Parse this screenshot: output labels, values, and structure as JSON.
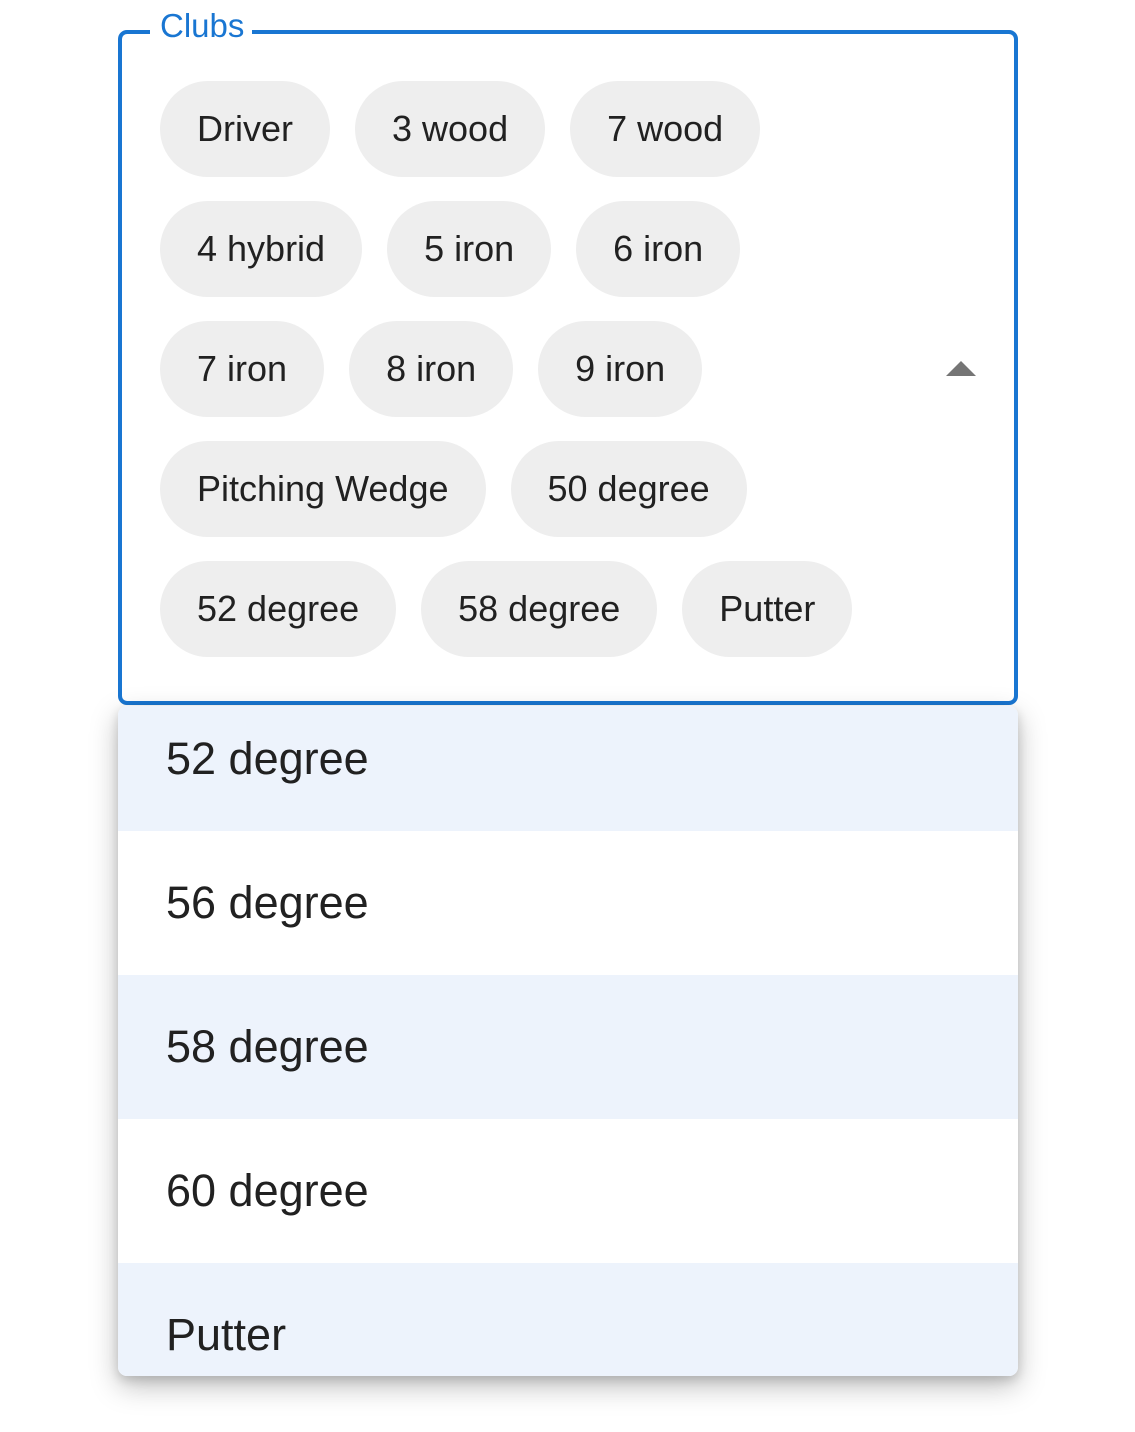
{
  "field": {
    "label": "Clubs",
    "accent_color": "#1976d2",
    "chip_rows": [
      [
        "Driver",
        "3 wood",
        "7 wood"
      ],
      [
        "4 hybrid",
        "5 iron",
        "6 iron"
      ],
      [
        "7 iron",
        "8 iron",
        "9 iron"
      ],
      [
        "Pitching Wedge",
        "50 degree"
      ],
      [
        "52 degree",
        "58 degree",
        "Putter"
      ]
    ],
    "dropdown_icon": "arrow-up-icon"
  },
  "menu": {
    "options": [
      {
        "label": "52 degree",
        "selected": true
      },
      {
        "label": "56 degree",
        "selected": false
      },
      {
        "label": "58 degree",
        "selected": true
      },
      {
        "label": "60 degree",
        "selected": false
      },
      {
        "label": "Putter",
        "selected": true
      }
    ],
    "selected_color": "#edf3fc"
  }
}
